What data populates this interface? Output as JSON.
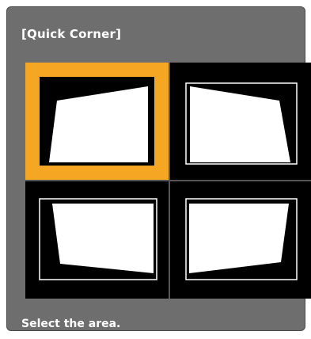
{
  "dialog": {
    "title": "[Quick Corner]",
    "status_text": "Select the area.",
    "accent_color": "#f5a623"
  },
  "corners": [
    {
      "label": "",
      "icon": "top-left-corner-icon",
      "selected": true
    },
    {
      "label": "",
      "icon": "top-right-corner-icon",
      "selected": false
    },
    {
      "label": "",
      "icon": "bottom-left-corner-icon",
      "selected": false
    },
    {
      "label": "",
      "icon": "bottom-right-corner-icon",
      "selected": false
    }
  ]
}
